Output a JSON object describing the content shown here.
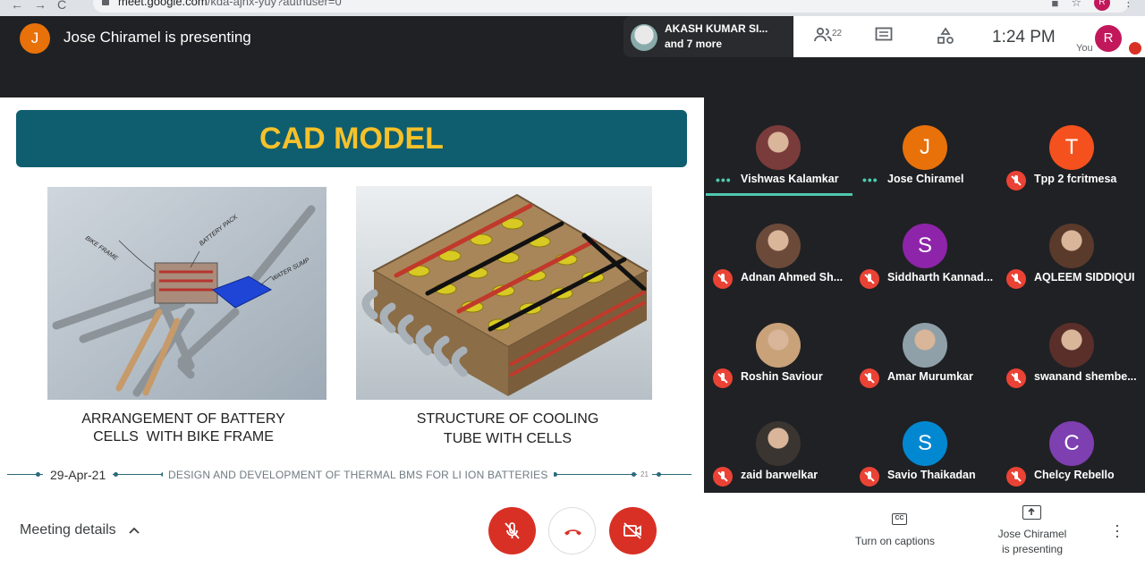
{
  "browser": {
    "url_host": "meet.google.com",
    "url_path": "/kda-ajnx-yuy?authuser=0",
    "profile_initial": "R"
  },
  "topbar": {
    "presenter_initial": "J",
    "presenting_text": "Jose Chiramel is presenting",
    "speaker_line1": "AKASH KUMAR SI...",
    "speaker_line2": "and 7 more",
    "participants_count": "22",
    "time": "1:24 PM",
    "you_label": "You",
    "you_initial": "R"
  },
  "slide": {
    "title": "CAD MODEL",
    "fig1_labels": {
      "bike_frame": "BIKE FRAME",
      "battery_pack": "BATTERY PACK",
      "water_sump": "WATER SUMP"
    },
    "caption1_line1": "ARRANGEMENT OF BATTERY",
    "caption1_line2": "CELLS  WITH BIKE FRAME",
    "caption2_line1": "STRUCTURE OF COOLING",
    "caption2_line2": "TUBE WITH CELLS",
    "footer_date": "29-Apr-21",
    "footer_title": "DESIGN AND DEVELOPMENT OF THERMAL BMS FOR LI ION BATTERIES",
    "footer_page": "21"
  },
  "participants": [
    {
      "name": "Vishwas Kalamkar",
      "initial": "",
      "color": "#7a3b3b",
      "speaking": true,
      "muted": false
    },
    {
      "name": "Jose Chiramel",
      "initial": "J",
      "color": "#e8710a",
      "speaking": true,
      "muted": false
    },
    {
      "name": "Tpp 2 fcritmesa",
      "initial": "T",
      "color": "#f4511e",
      "speaking": false,
      "muted": true
    },
    {
      "name": "Adnan Ahmed Sh...",
      "initial": "",
      "color": "#6b4a3a",
      "speaking": false,
      "muted": true
    },
    {
      "name": "Siddharth Kannad...",
      "initial": "S",
      "color": "#8e24aa",
      "speaking": false,
      "muted": true
    },
    {
      "name": "AQLEEM SIDDIQUI",
      "initial": "",
      "color": "#5a3a2a",
      "speaking": false,
      "muted": true
    },
    {
      "name": "Roshin Saviour",
      "initial": "",
      "color": "#c9a27a",
      "speaking": false,
      "muted": true
    },
    {
      "name": "Amar Murumkar",
      "initial": "",
      "color": "#8fa0a8",
      "speaking": false,
      "muted": true
    },
    {
      "name": "swanand shembe...",
      "initial": "",
      "color": "#5a2f2a",
      "speaking": false,
      "muted": true
    },
    {
      "name": "zaid barwelkar",
      "initial": "",
      "color": "#3a3530",
      "speaking": false,
      "muted": true
    },
    {
      "name": "Savio Thaikadan",
      "initial": "S",
      "color": "#0288d1",
      "speaking": false,
      "muted": true
    },
    {
      "name": "Chelcy Rebello",
      "initial": "C",
      "color": "#7e3fb1",
      "speaking": false,
      "muted": true
    }
  ],
  "bottombar": {
    "meeting_details": "Meeting details",
    "captions_label": "Turn on captions",
    "cc_icon_text": "CC",
    "presenting_label": "Jose Chiramel is presenting"
  },
  "colors": {
    "accent_teal": "#4ec9b0",
    "mute_red": "#d93025",
    "slide_title_bg": "#0e5e6f",
    "slide_title_text": "#f6c12a"
  }
}
